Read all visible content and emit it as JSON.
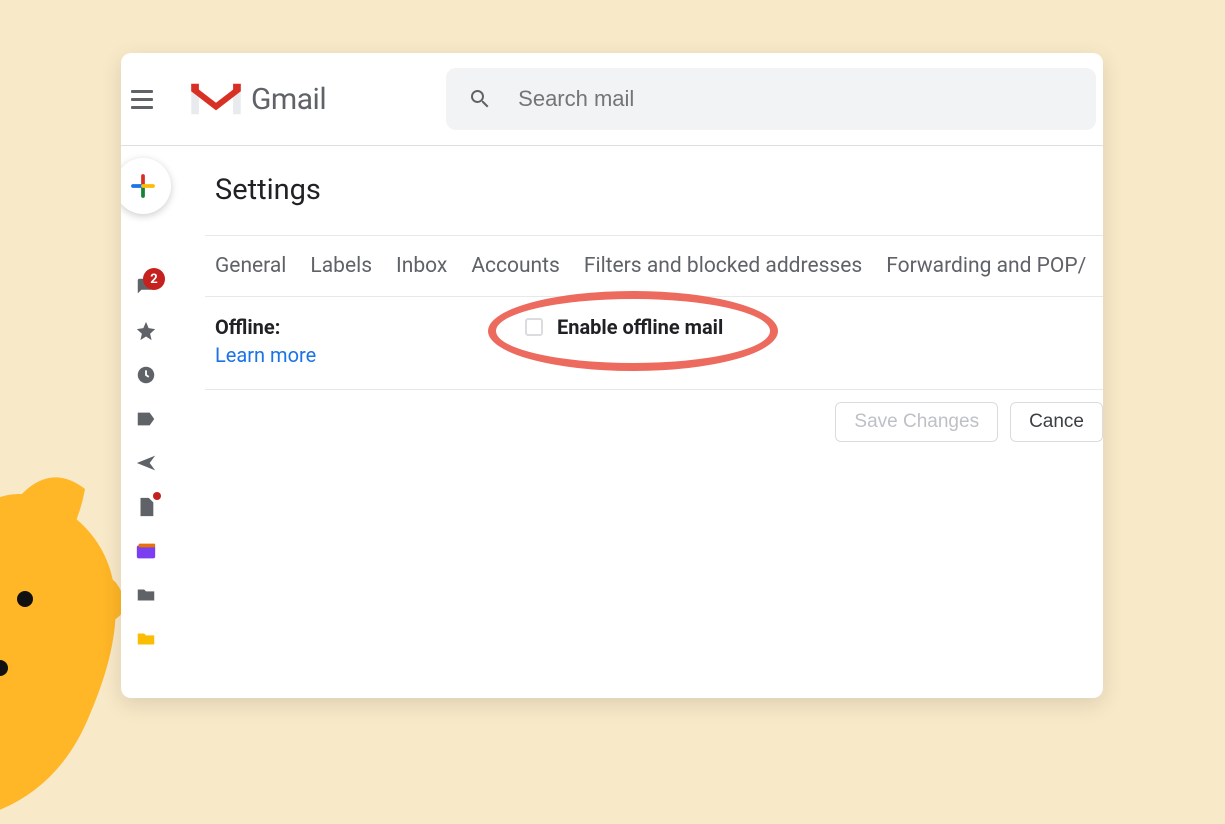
{
  "header": {
    "app_name": "Gmail",
    "search_placeholder": "Search mail"
  },
  "sidebar": {
    "inbox_badge": "2"
  },
  "settings": {
    "page_title": "Settings",
    "tabs": [
      "General",
      "Labels",
      "Inbox",
      "Accounts",
      "Filters and blocked addresses",
      "Forwarding and POP/"
    ],
    "offline": {
      "label": "Offline:",
      "learn_more": "Learn more",
      "checkbox_label": "Enable offline mail"
    },
    "buttons": {
      "save": "Save Changes",
      "cancel": "Cance"
    }
  }
}
